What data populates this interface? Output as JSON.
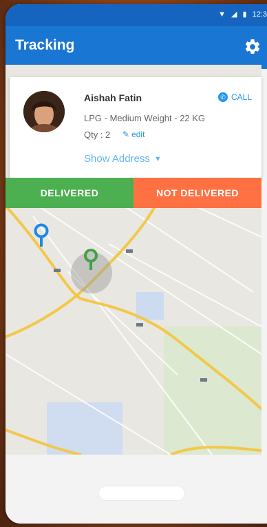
{
  "status_bar": {
    "time": "12:3"
  },
  "app_bar": {
    "title": "Tracking",
    "settings_icon": "gear-icon"
  },
  "order": {
    "customer_name": "Aishah Fatin",
    "product": "LPG - Medium Weight - 22 KG",
    "qty": "Qty : 2",
    "edit_label": "edit",
    "call_label": "CALL",
    "show_address_label": "Show Address"
  },
  "actions": {
    "delivered_label": "DELIVERED",
    "not_delivered_label": "NOT DELIVERED"
  },
  "colors": {
    "primary": "#1976d2",
    "delivered": "#4caf50",
    "not_delivered": "#ff7043",
    "accent": "#2196f3",
    "marker_blue": "#1e88e5",
    "marker_green": "#43a047"
  }
}
